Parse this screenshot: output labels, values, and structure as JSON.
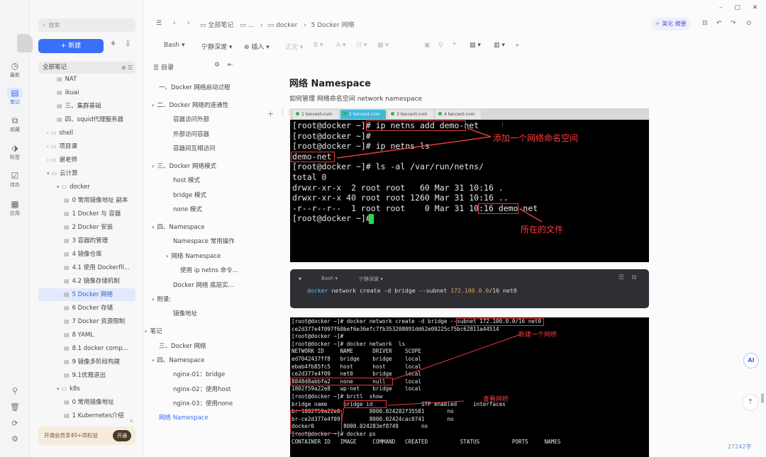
{
  "rail": {
    "items": [
      {
        "icon": "clock-icon",
        "glyph": "◷",
        "label": "最新"
      },
      {
        "icon": "note-icon",
        "glyph": "▤",
        "label": "笔记"
      },
      {
        "icon": "bookmark-icon",
        "glyph": "⧉",
        "label": "收藏"
      },
      {
        "icon": "tag-icon",
        "glyph": "⬗",
        "label": "标签"
      },
      {
        "icon": "todo-icon",
        "glyph": "☑",
        "label": "待办"
      },
      {
        "icon": "apps-icon",
        "glyph": "▦",
        "label": "应用"
      }
    ]
  },
  "sidebar": {
    "search_placeholder": "搜索",
    "new_label": "+ 新建",
    "all_notes": "全部笔记",
    "tree": [
      {
        "label": "NAT",
        "kind": "file",
        "level": 2
      },
      {
        "label": "ikuai",
        "kind": "file",
        "level": 2
      },
      {
        "label": "三、集群基础",
        "kind": "file",
        "level": 2
      },
      {
        "label": "四、squid代理服务器",
        "kind": "file",
        "level": 2
      },
      {
        "label": "shell",
        "kind": "folder",
        "level": 1
      },
      {
        "label": "项目课",
        "kind": "folder",
        "level": 1
      },
      {
        "label": "谢老师",
        "kind": "folder",
        "level": 1
      },
      {
        "label": "云计算",
        "kind": "folder-open",
        "level": 1
      },
      {
        "label": "docker",
        "kind": "folder-open",
        "level": 2
      },
      {
        "label": "0 常用镜像地址 副本",
        "kind": "file",
        "level": 3
      },
      {
        "label": "1 Docker 与 容器",
        "kind": "file",
        "level": 3
      },
      {
        "label": "2 Docker 安装",
        "kind": "file",
        "level": 3
      },
      {
        "label": "3 容器的管理",
        "kind": "file",
        "level": 3
      },
      {
        "label": "4 镜像仓库",
        "kind": "file",
        "level": 3
      },
      {
        "label": "4.1 使用 Dockerfil...",
        "kind": "file",
        "level": 3
      },
      {
        "label": "4.2 镜像存储机制",
        "kind": "file",
        "level": 3
      },
      {
        "label": "5 Docker 网络",
        "kind": "file",
        "level": 3,
        "selected": true
      },
      {
        "label": "6 Docker 存储",
        "kind": "file",
        "level": 3
      },
      {
        "label": "7 Docker 资源限制",
        "kind": "file",
        "level": 3
      },
      {
        "label": "8 YAML",
        "kind": "file",
        "level": 3
      },
      {
        "label": "8.1 docker comp...",
        "kind": "file",
        "level": 3
      },
      {
        "label": "9 镜像多阶段构建",
        "kind": "file",
        "level": 3
      },
      {
        "label": "9.1优雅退出",
        "kind": "file",
        "level": 3
      },
      {
        "label": "k8s",
        "kind": "folder-open",
        "level": 2
      },
      {
        "label": "0 常用镜像地址",
        "kind": "file",
        "level": 3
      },
      {
        "label": "1 Kubernetes介绍",
        "kind": "file",
        "level": 3
      }
    ],
    "promo_text": "开通会员享40+项权益",
    "promo_button": "开通"
  },
  "topbar": {
    "breadcrumb": [
      "全部笔记",
      "...",
      "docker",
      "5 Docker 网络"
    ],
    "ai_label": "美化 摘要"
  },
  "format": {
    "lang": "Bash",
    "theme": "宁静深邃",
    "insert": "插入",
    "body": "正文"
  },
  "toc": {
    "title": "目录",
    "items": [
      {
        "label": "一、Docker 网络启动过程",
        "level": 1
      },
      {
        "label": "二、Docker 网络的连通性",
        "level": 1,
        "caret": true
      },
      {
        "label": "容器访问外部",
        "level": 2
      },
      {
        "label": "外部访问容器",
        "level": 2
      },
      {
        "label": "容器间互相访问",
        "level": 2
      },
      {
        "label": "三、Docker 网络模式",
        "level": 1,
        "caret": true
      },
      {
        "label": "host 模式",
        "level": 2
      },
      {
        "label": "bridge 模式",
        "level": 2
      },
      {
        "label": "none 模式",
        "level": 2
      },
      {
        "label": "四、Namespace",
        "level": 1,
        "caret": true
      },
      {
        "label": "Namespace 常用操作",
        "level": 2
      },
      {
        "label": "网络 Namespace",
        "level": 2,
        "caret": true
      },
      {
        "label": "使用 ip netns 命令...",
        "level": 3
      },
      {
        "label": "Docker 网络 底层实...",
        "level": 2
      },
      {
        "label": "附录:",
        "level": 1,
        "caret": true
      },
      {
        "label": "镜像地址",
        "level": 2
      },
      {
        "label": "笔记",
        "level": 0,
        "caret": true
      },
      {
        "label": "三、Docker 网络",
        "level": 1
      },
      {
        "label": "四、Namespace",
        "level": 1,
        "caret": true
      },
      {
        "label": "nginx-01：bridge",
        "level": 2
      },
      {
        "label": "nginx-02：使用host",
        "level": 2
      },
      {
        "label": "nginx-03：使用none",
        "level": 2
      },
      {
        "label": "网络 Namespace",
        "level": 1,
        "active": true
      }
    ]
  },
  "main": {
    "heading": "网络 Namespace",
    "subtitle": "如何管理 网络命名空间 network namespace"
  },
  "shot1": {
    "tabs": [
      "1 tencent-cvm",
      "2 tencent-cvm",
      "3 tencent-cvm",
      "4 tencent-cvm"
    ],
    "lines": [
      "[root@docker ~]# ip netns add demo-net",
      "[root@docker ~]#",
      "[root@docker ~]# ip netns ls",
      "demo-net",
      "[root@docker ~]# ls -al /var/run/netns/",
      "total 0",
      "drwxr-xr-x  2 root root   60 Mar 31 10:16 .",
      "drwxr-xr-x 40 root root 1260 Mar 31 10:16 ..",
      "-r--r--r--  1 root root    0 Mar 31 10:16 demo-net",
      "[root@docker ~]#"
    ],
    "note_add": "添加一个网络命名空间",
    "note_file": "所在的文件"
  },
  "code": {
    "lang": "Bash",
    "theme": "宁静深邃",
    "cmd_kw": "docker",
    "cmd_mid": " network create -d bridge --subnet ",
    "cmd_num": "172.100.0.0",
    "cmd_end": "/16 net0"
  },
  "shot2": {
    "lines": [
      "[root@docker ~]# docker network create -d bridge --subnet 172.100.0.0/16 net0",
      "ce2d377e4f097f60bef6e36efc7fb353208091dd62e09225c75bc62811a44514",
      "[root@docker ~]#",
      "[root@docker ~]# docker network  ls",
      "NETWORK ID     NAME      DRIVER    SCOPE",
      "ed7042437ff8   bridge    bridge    local",
      "ebab4fb85fc5   host      host      local",
      "ce2d377e4f09   net0      bridge    local",
      "8848d8abbfa2   none      null      local",
      "1802f59a22e8   wp-net    bridge    local",
      "[root@docker ~]# brctl  show",
      "bridge name     bridge id               STP enabled     interfaces",
      "br-1802f59a22e8         8000.024282f35581       no",
      "br-ce2d377e4f09         8000.02424cac0741       no",
      "docker0         8000.024283ef8749       no",
      "[root@docker ~]# docker ps",
      "CONTAINER ID   IMAGE     COMMAND   CREATED          STATUS          PORTS     NAMES"
    ],
    "note_bridge": "新建一个网桥",
    "note_view": "查看网桥"
  },
  "status": {
    "word_count": "27242字",
    "ai_badge": "AI"
  }
}
